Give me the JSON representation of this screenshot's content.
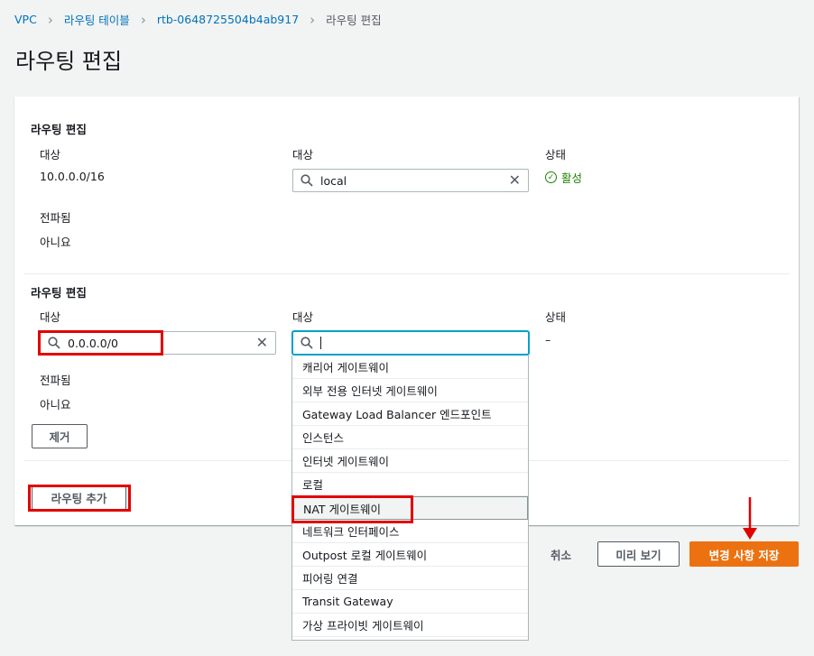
{
  "breadcrumb": {
    "items": [
      "VPC",
      "라우팅 테이블",
      "rtb-0648725504b4ab917"
    ],
    "current": "라우팅 편집"
  },
  "page_title": "라우팅 편집",
  "route1": {
    "section_title": "라우팅 편집",
    "dest_label": "대상",
    "dest_value": "10.0.0.0/16",
    "target_label": "대상",
    "target_value": "local",
    "status_label": "상태",
    "status_value": "활성",
    "propagated_label": "전파됨",
    "propagated_value": "아니요"
  },
  "route2": {
    "section_title": "라우팅 편집",
    "dest_label": "대상",
    "dest_value": "0.0.0.0/0",
    "target_label": "대상",
    "status_label": "상태",
    "status_value": "–",
    "propagated_label": "전파됨",
    "propagated_value": "아니요",
    "remove_label": "제거"
  },
  "add_route_label": "라우팅 추가",
  "dropdown": {
    "options": [
      "캐리어 게이트웨이",
      "외부 전용 인터넷 게이트웨이",
      "Gateway Load Balancer 엔드포인트",
      "인스턴스",
      "인터넷 게이트웨이",
      "로컬",
      "NAT 게이트웨이",
      "네트워크 인터페이스",
      "Outpost 로컬 게이트웨이",
      "피어링 연결",
      "Transit Gateway",
      "가상 프라이빗 게이트웨이"
    ],
    "highlighted_index": 6
  },
  "footer": {
    "cancel_label": "취소",
    "preview_label": "미리 보기",
    "save_label": "변경 사항 저장"
  },
  "colors": {
    "link": "#0073bb",
    "primary": "#ec7211",
    "success": "#1d8102",
    "annotation": "#e10000"
  }
}
